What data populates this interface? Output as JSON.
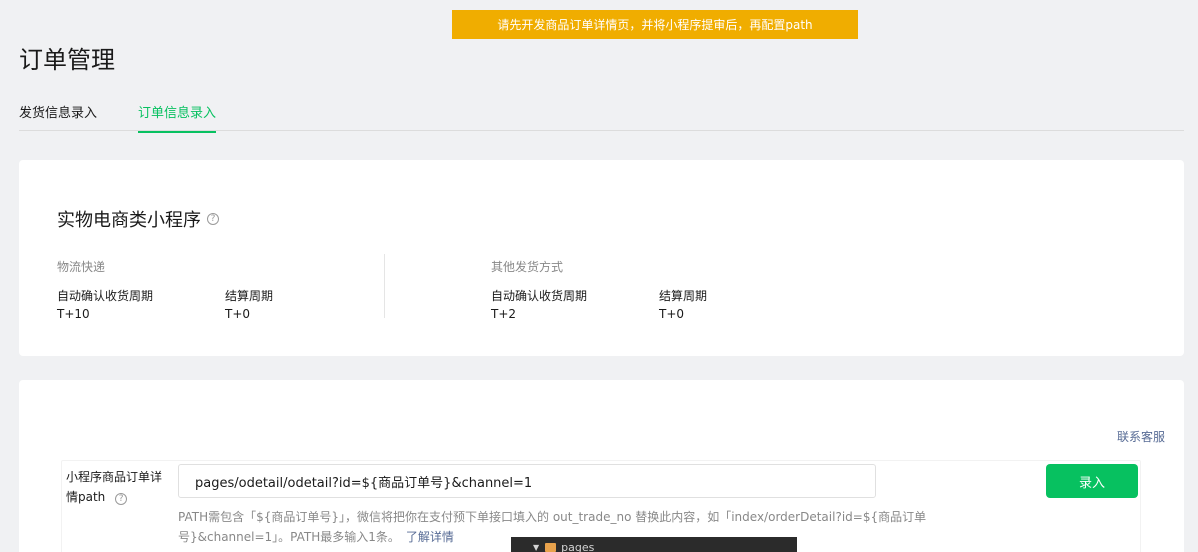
{
  "toast": {
    "text": "请先开发商品订单详情页，并将小程序提审后，再配置path"
  },
  "page": {
    "title": "订单管理"
  },
  "tabs": [
    {
      "label": "发货信息录入",
      "active": false
    },
    {
      "label": "订单信息录入",
      "active": true
    }
  ],
  "summary": {
    "title": "实物电商类小程序",
    "help_icon": "question-circle-icon",
    "logistics": {
      "title": "物流快递",
      "auto_confirm_label": "自动确认收货周期",
      "auto_confirm_value": "T+10",
      "settlement_label": "结算周期",
      "settlement_value": "T+0"
    },
    "other": {
      "title": "其他发货方式",
      "auto_confirm_label": "自动确认收货周期",
      "auto_confirm_value": "T+2",
      "settlement_label": "结算周期",
      "settlement_value": "T+0"
    }
  },
  "path_config": {
    "contact_label": "联系客服",
    "label": "小程序商品订单详情path",
    "input_value": "pages/odetail/odetail?id=${商品订单号}&channel=1",
    "submit_label": "录入",
    "hint": "PATH需包含「${商品订单号}」，微信将把你在支付预下单接口填入的 out_trade_no 替换此内容，如「index/orderDetail?id=${商品订单号}&channel=1」。PATH最多输入1条。",
    "hint_link": "了解详情"
  },
  "overlay": {
    "folder_label": "pages"
  },
  "colors": {
    "accent": "#07c160",
    "toast": "#f0ad00",
    "link": "#576b95"
  }
}
